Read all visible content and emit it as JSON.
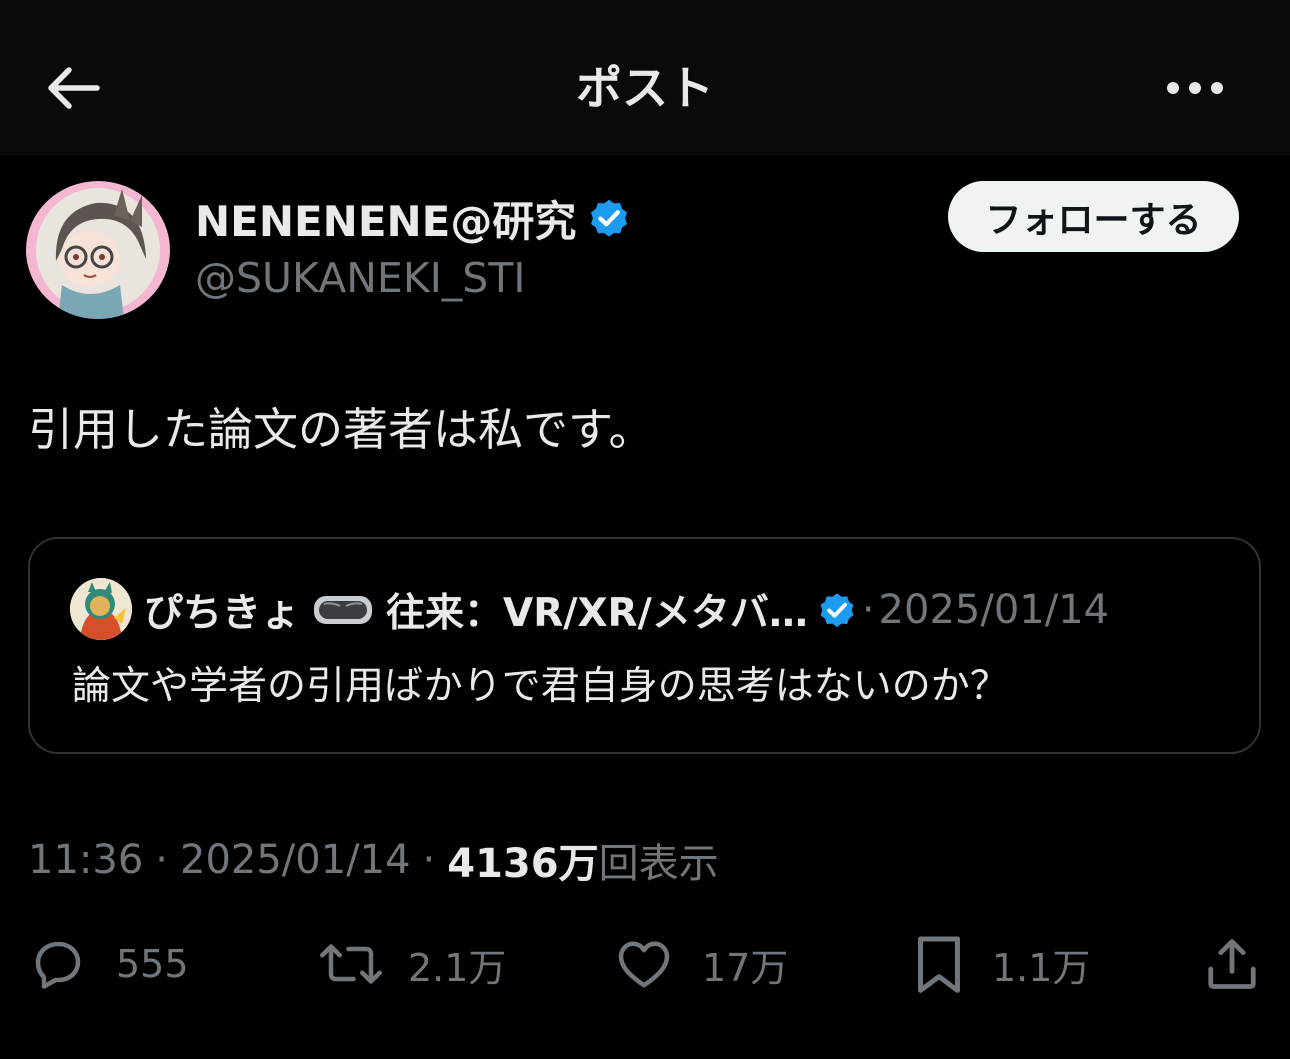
{
  "header": {
    "title": "ポスト",
    "back_icon": "arrow-left-icon",
    "more_icon": "more-horizontal-icon"
  },
  "author": {
    "display_name": "NENENENE@研究",
    "handle": "@SUKANEKI_STI",
    "verified": true,
    "follow_label": "フォローする"
  },
  "post": {
    "text": "引用した論文の著者は私です。"
  },
  "quote": {
    "display_name": "ぴちきょ",
    "name_suffix": "往来：VR/XR/メタバ…",
    "separator": "·",
    "date": "2025/01/14",
    "text": "論文や学者の引用ばかりで君自身の思考はないのか？"
  },
  "meta": {
    "time": "11:36",
    "sep1": "·",
    "date": "2025/01/14",
    "sep2": "·",
    "views_count": "4136万",
    "views_label": "回表示"
  },
  "actions": {
    "reply_count": "555",
    "repost_count": "2.1万",
    "like_count": "17万",
    "bookmark_count": "1.1万"
  },
  "colors": {
    "background": "#000000",
    "text_primary": "#e7e9ea",
    "text_secondary": "#71767b",
    "verified_blue": "#1d9bf0",
    "border": "#2f3336",
    "follow_bg": "#eff3f4"
  }
}
